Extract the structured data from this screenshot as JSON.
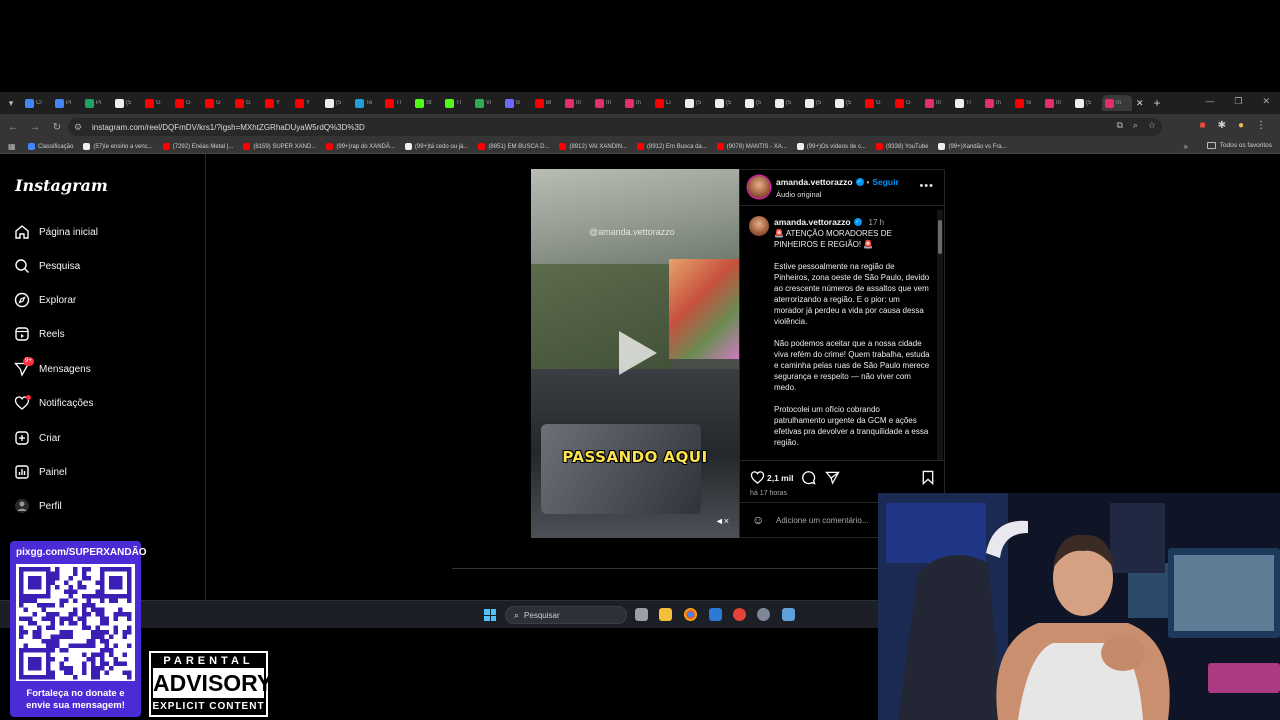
{
  "browser": {
    "tabs": [
      {
        "title": "Cl",
        "color": "#4285f4"
      },
      {
        "title": "Pi",
        "color": "#4285f4"
      },
      {
        "title": "Pi",
        "color": "#1ea362"
      },
      {
        "title": "(5",
        "color": "#eeeeee"
      },
      {
        "title": "G",
        "color": "#ff0000"
      },
      {
        "title": "G",
        "color": "#ff0000"
      },
      {
        "title": "G",
        "color": "#ff0000"
      },
      {
        "title": "G",
        "color": "#ff0000"
      },
      {
        "title": "Y",
        "color": "#ff0000"
      },
      {
        "title": "Y",
        "color": "#ff0000"
      },
      {
        "title": "(5",
        "color": "#eeeeee"
      },
      {
        "title": "Te",
        "color": "#229ed9"
      },
      {
        "title": "Tl",
        "color": "#ff0000"
      },
      {
        "title": "St",
        "color": "#53fc18"
      },
      {
        "title": "Tl",
        "color": "#53fc18"
      },
      {
        "title": "Vi",
        "color": "#34a853"
      },
      {
        "title": "B",
        "color": "#6b6bff"
      },
      {
        "title": "Bl",
        "color": "#ff0000"
      },
      {
        "title": "In",
        "color": "#e1306c"
      },
      {
        "title": "In",
        "color": "#e1306c"
      },
      {
        "title": "In",
        "color": "#e1306c"
      },
      {
        "title": "Li",
        "color": "#ff0000"
      },
      {
        "title": "(5",
        "color": "#eeeeee"
      },
      {
        "title": "(5",
        "color": "#eeeeee"
      },
      {
        "title": "(5",
        "color": "#eeeeee"
      },
      {
        "title": "(5",
        "color": "#eeeeee"
      },
      {
        "title": "(5",
        "color": "#eeeeee"
      },
      {
        "title": "(5",
        "color": "#eeeeee"
      },
      {
        "title": "G",
        "color": "#ff0000"
      },
      {
        "title": "G",
        "color": "#ff0000"
      },
      {
        "title": "In",
        "color": "#e1306c"
      },
      {
        "title": "Ti",
        "color": "#eeeeee"
      },
      {
        "title": "In",
        "color": "#e1306c"
      },
      {
        "title": "Si",
        "color": "#ff0000"
      },
      {
        "title": "In",
        "color": "#e1306c"
      },
      {
        "title": "(5",
        "color": "#eeeeee"
      },
      {
        "title": "In",
        "color": "#e1306c",
        "active": true
      }
    ],
    "url": "instagram.com/reel/DQFmDV/krs1/?igsh=MXhtZGRhaDUyaW5rdQ%3D%3D",
    "bookmarks": [
      {
        "title": "Classificação",
        "color": "#4285f4"
      },
      {
        "title": "(57)Ie ensino a venc...",
        "color": "#eeeeee"
      },
      {
        "title": "(7292) Enéas Metal |...",
        "color": "#ff0000"
      },
      {
        "title": "(8159) SUPER XAND...",
        "color": "#ff0000"
      },
      {
        "title": "(99+)rap do XANDÃ...",
        "color": "#ff0000"
      },
      {
        "title": "(99+)tá cedo ou já...",
        "color": "#eeeeee"
      },
      {
        "title": "(8851) EM BUSCA D...",
        "color": "#ff0000"
      },
      {
        "title": "(8912) VAI XANDIN...",
        "color": "#ff0000"
      },
      {
        "title": "(8912) Em Busca da...",
        "color": "#ff0000"
      },
      {
        "title": "(9078) MANTIS - XA...",
        "color": "#ff0000"
      },
      {
        "title": "(99+)Os vídeos de c...",
        "color": "#eeeeee"
      },
      {
        "title": "(9338) YouTube",
        "color": "#ff0000"
      },
      {
        "title": "(99+)Xandão vs Fra...",
        "color": "#eeeeee"
      }
    ],
    "favorites_label": "Todos os favoritos"
  },
  "instagram": {
    "logo": "Instagram",
    "nav": [
      {
        "label": "Página inicial",
        "icon": "home-icon"
      },
      {
        "label": "Pesquisa",
        "icon": "search-icon"
      },
      {
        "label": "Explorar",
        "icon": "compass-icon"
      },
      {
        "label": "Reels",
        "icon": "reels-icon"
      },
      {
        "label": "Mensagens",
        "icon": "messages-icon",
        "badge": "9+"
      },
      {
        "label": "Notificações",
        "icon": "heart-icon",
        "dot": true
      },
      {
        "label": "Criar",
        "icon": "plus-icon"
      },
      {
        "label": "Painel",
        "icon": "dashboard-icon"
      },
      {
        "label": "Perfil",
        "icon": "profile-icon"
      }
    ],
    "reel": {
      "watermark": "@amanda.vettorazzo",
      "caption": "PASSANDO AQUI"
    },
    "post": {
      "username": "amanda.vettorazzo",
      "follow": "Seguir",
      "audio": "Áudio original",
      "caption_time": "17 h",
      "caption_paragraphs": [
        "🚨 ATENÇÃO MORADORES DE PINHEIROS E REGIÃO! 🚨",
        "Estive pessoalmente na região de Pinheiros, zona oeste de São Paulo, devido ao crescente números de assaltos que vem aterrorizando a região. E o pior: um morador já perdeu a vida por causa dessa violência.",
        "Não podemos aceitar que a nossa cidade viva refém do crime! Quem trabalha, estuda e caminha pelas ruas de São Paulo merece segurança e respeito — não viver com medo.",
        "Protocolei um ofício cobrando patrulhamento urgente da GCM e ações efetivas pra devolver a tranquilidade a essa região."
      ],
      "likes": "2,1 mil",
      "posted_ago": "há 17 horas",
      "comment_placeholder": "Adicione um comentário..."
    }
  },
  "taskbar": {
    "search_placeholder": "Pesquisar"
  },
  "overlay": {
    "donate_url": "pixgg.com/SUPERXANDÃO",
    "donate_caption": "Fortaleça no donate e envie sua mensagem!",
    "parental_top": "PARENTAL",
    "parental_mid": "ADVISORY",
    "parental_bottom": "EXPLICIT CONTENT"
  }
}
